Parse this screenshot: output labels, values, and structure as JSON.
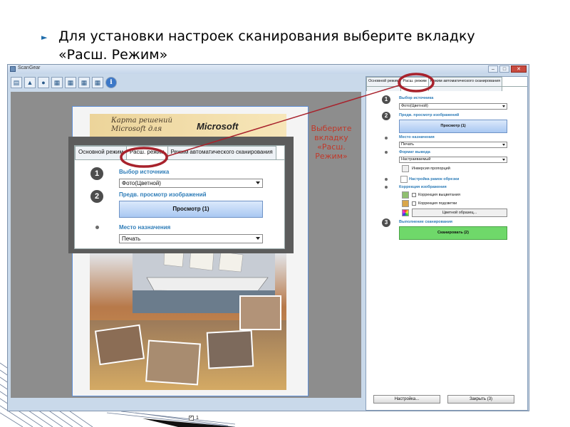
{
  "slide": {
    "bullet_text": "Для установки настроек сканирования выберите вкладку «Расш. Режим»",
    "callout_text": "Выберите вкладку «Расш. Режим»",
    "accent_red": "#c0392b",
    "bullet_color": "#1f6dab"
  },
  "window": {
    "title": "ScanGear",
    "controls": {
      "minimize": "–",
      "maximize": "□",
      "close": "✕"
    },
    "toolbar_icons": [
      "scanner-icon",
      "photo-icon",
      "person-icon",
      "grid-icon",
      "grid-icon",
      "grid-icon",
      "grid-icon",
      "info-icon"
    ],
    "info_label": "i"
  },
  "preview": {
    "poster_title_left": "Карта решений Microsoft для",
    "poster_brand": "Microsoft",
    "page_number": "1"
  },
  "zoom_panel": {
    "tabs": [
      "Основной режим",
      "Расш. режим",
      "Режим автоматического сканирования"
    ],
    "step1_number": "1",
    "step1_label": "Выбор источника",
    "source_value": "Фото(Цветной)",
    "step2_number": "2",
    "preview_label": "Предв. просмотр изображений",
    "preview_button": "Просмотр (1)",
    "destination_label": "Место назначения",
    "destination_value": "Печать"
  },
  "settings_panel": {
    "tabs": [
      "Основной режим",
      "Расш. режим",
      "Режим автоматического сканирования"
    ],
    "step1_number": "1",
    "source_label": "Выбор источника",
    "source_value": "Фото(Цветной)",
    "step2_number": "2",
    "preview_label": "Предв. просмотр изображений",
    "preview_button": "Просмотр (1)",
    "destination_label": "Место назначения",
    "destination_value": "Печать",
    "output_label": "Формат вывода",
    "output_value": "Настраиваемый",
    "invert_label": "Инверсия пропорций",
    "frame_label": "Настройка рамок обрезки",
    "correction_label": "Коррекция изображения",
    "fade_label": "Коррекция выцветания",
    "backlight_label": "Коррекция подсветки",
    "color_button": "Цветной образец...",
    "step3_number": "3",
    "scan_label": "Выполнение сканирования",
    "scan_button": "Сканировать (2)",
    "scan_button_color": "#6fd86a"
  },
  "footer": {
    "settings_button": "Настройка...",
    "close_button": "Закрыть (3)"
  }
}
